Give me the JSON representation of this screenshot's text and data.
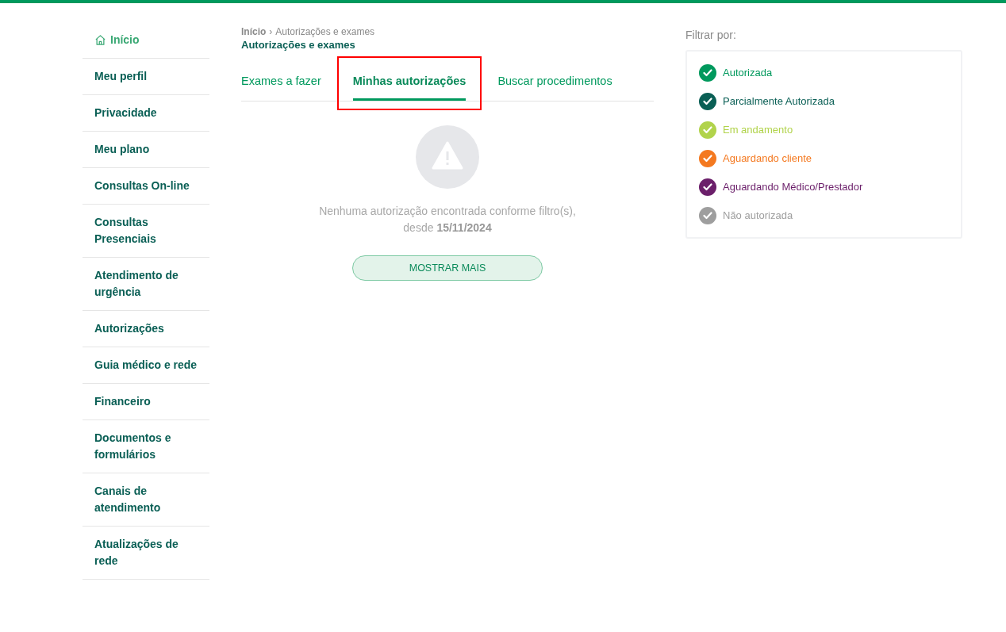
{
  "sidebar": {
    "items": [
      {
        "label": "Início",
        "selected": true,
        "kind": "home"
      },
      {
        "label": "Meu perfil",
        "selected": false
      },
      {
        "label": "Privacidade",
        "selected": false
      },
      {
        "label": "Meu plano",
        "selected": false
      },
      {
        "label": "Consultas On-line",
        "selected": false
      },
      {
        "label": "Consultas Presenciais",
        "selected": false
      },
      {
        "label": "Atendimento de urgência",
        "selected": false
      },
      {
        "label": "Autorizações",
        "selected": false
      },
      {
        "label": "Guia médico e rede",
        "selected": false
      },
      {
        "label": "Financeiro",
        "selected": false
      },
      {
        "label": "Documentos e formulários",
        "selected": false
      },
      {
        "label": "Canais de atendimento",
        "selected": false
      },
      {
        "label": "Atualizações de rede",
        "selected": false
      }
    ]
  },
  "breadcrumb": {
    "items": [
      "Início",
      "Autorizações e exames"
    ],
    "separator": "›"
  },
  "page_title": "Autorizações e exames",
  "tabs": [
    {
      "label": "Exames a fazer",
      "selected": false,
      "highlighted": false
    },
    {
      "label": "Minhas autorizações",
      "selected": true,
      "highlighted": true
    },
    {
      "label": "Buscar procedimentos",
      "selected": false,
      "highlighted": false
    }
  ],
  "empty_state": {
    "message": "Nenhuma autorização encontrada conforme filtro(s), desde",
    "date": "15/11/2024"
  },
  "show_more_button": "MOSTRAR MAIS",
  "filter": {
    "title": "Filtrar por:",
    "options": [
      {
        "label": "Autorizada",
        "checked": true,
        "color": "#00995d"
      },
      {
        "label": "Parcialmente Autorizada",
        "checked": true,
        "color": "#0a5f55"
      },
      {
        "label": "Em andamento",
        "checked": true,
        "color": "#b1d34b"
      },
      {
        "label": "Aguardando cliente",
        "checked": true,
        "color": "#f47920"
      },
      {
        "label": "Aguardando Médico/Prestador",
        "checked": true,
        "color": "#6b1f6a"
      },
      {
        "label": "Não autorizada",
        "checked": true,
        "color": "#9e9e9e"
      }
    ]
  }
}
